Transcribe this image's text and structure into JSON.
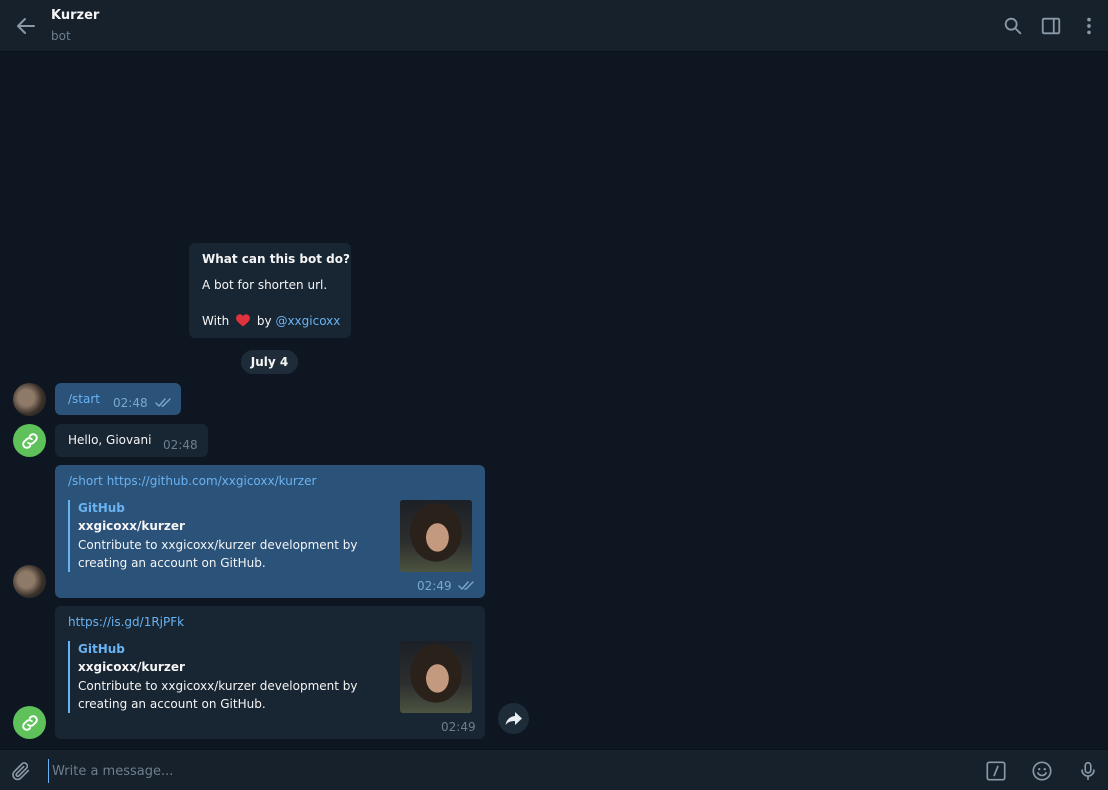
{
  "header": {
    "title": "Kurzer",
    "subtitle": "bot"
  },
  "bot_info": {
    "title": "What can this bot do?",
    "line1": "A bot for shorten url.",
    "with_text": "With",
    "by_text": "by",
    "mention": "@xxgicoxx"
  },
  "date_separator": "July 4",
  "messages": [
    {
      "text": "/start",
      "time": "02:48"
    },
    {
      "text": "Hello, Giovani",
      "time": "02:48"
    },
    {
      "text": "/short https://github.com/xxgicoxx/kurzer",
      "time": "02:49",
      "preview": {
        "site": "GitHub",
        "title": "xxgicoxx/kurzer",
        "desc": "Contribute to xxgicoxx/kurzer development by creating an account on GitHub."
      }
    },
    {
      "text": "https://is.gd/1RjPFk",
      "time": "02:49",
      "preview": {
        "site": "GitHub",
        "title": "xxgicoxx/kurzer",
        "desc": "Contribute to xxgicoxx/kurzer development by creating an account on GitHub."
      }
    }
  ],
  "composer": {
    "placeholder": "Write a message..."
  },
  "icons": {
    "back": "arrow-left-icon",
    "search": "search-icon",
    "sidebar": "sidebar-toggle-icon",
    "more": "more-vertical-icon",
    "attach": "paperclip-icon",
    "commands": "slash-command-icon",
    "emoji": "emoji-icon",
    "mic": "microphone-icon",
    "forward": "forward-icon",
    "bot_avatar": "link-icon"
  },
  "colors": {
    "accent": "#6ab3f3",
    "outgoing_bubble": "#2b5278",
    "incoming_bubble": "#182533",
    "background": "#0e1621",
    "bot_avatar": "#5fc15a",
    "heart": "#e0323c"
  }
}
